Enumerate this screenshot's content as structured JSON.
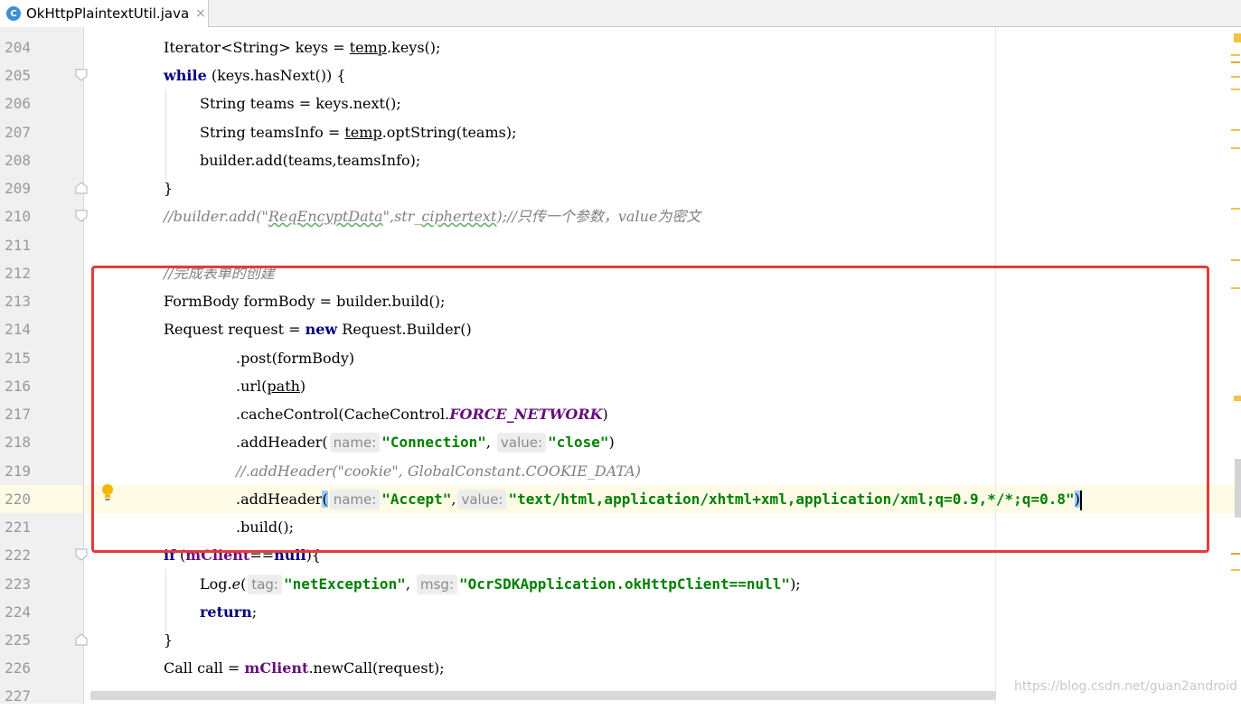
{
  "tab": {
    "icon_letter": "C",
    "title": "OkHttpPlaintextUtil.java",
    "close_glyph": "×"
  },
  "lines": [
    {
      "n": "204"
    },
    {
      "n": "205"
    },
    {
      "n": "206"
    },
    {
      "n": "207"
    },
    {
      "n": "208"
    },
    {
      "n": "209"
    },
    {
      "n": "210"
    },
    {
      "n": "211"
    },
    {
      "n": "212"
    },
    {
      "n": "213"
    },
    {
      "n": "214"
    },
    {
      "n": "215"
    },
    {
      "n": "216"
    },
    {
      "n": "217"
    },
    {
      "n": "218"
    },
    {
      "n": "219"
    },
    {
      "n": "220"
    },
    {
      "n": "221"
    },
    {
      "n": "222"
    },
    {
      "n": "223"
    },
    {
      "n": "224"
    },
    {
      "n": "225"
    },
    {
      "n": "226"
    },
    {
      "n": "227"
    }
  ],
  "code": {
    "l204": "Iterator<String> keys = ",
    "l204_temp": "temp",
    "l204_tail": ".keys();",
    "l205_kw": "while",
    "l205_tail": " (keys.hasNext()) {",
    "l206": "String teams = keys.next();",
    "l207_a": "String teamsInfo = ",
    "l207_temp": "temp",
    "l207_b": ".optString(teams);",
    "l208": "builder.add(teams,teamsInfo);",
    "l209": "}",
    "l210_a": "//builder.add(\"",
    "l210_wavy": "ReqEncyptData",
    "l210_b": "\",str_",
    "l210_wavy2": "ciphertext",
    "l210_c": ");//只传一个参数，value为密文",
    "l212": "//完成表单的创建",
    "l213": "FormBody formBody = builder.build();",
    "l214_a": "Request request = ",
    "l214_kw": "new",
    "l214_b": " Request.Builder()",
    "l215": ".post(formBody)",
    "l216_a": ".url(",
    "l216_path": "path",
    "l216_b": ")",
    "l217_a": ".cacheControl(CacheControl.",
    "l217_fld": "FORCE_NETWORK",
    "l217_b": ")",
    "l218_a": ".addHeader(",
    "l218_hint1": "name:",
    "l218_s1": "\"Connection\"",
    "l218_comma": ", ",
    "l218_hint2": "value:",
    "l218_s2": "\"close\"",
    "l218_b": ")",
    "l219": "//.addHeader(\"cookie\", GlobalConstant.COOKIE_DATA)",
    "l220_a": ".addHeader",
    "l220_open": "(",
    "l220_hint1": "name:",
    "l220_s1": "\"Accept\"",
    "l220_comma": ",",
    "l220_hint2": "value:",
    "l220_s2": "\"text/html,application/xhtml+xml,application/xml;q=0.9,*/*;q=0.8\"",
    "l220_close": ")",
    "l221": ".build();",
    "l222_kw": "if",
    "l222_a": " (",
    "l222_fld": "mClient",
    "l222_b": "==",
    "l222_null": "null",
    "l222_c": "){",
    "l223_a": "Log.",
    "l223_e": "e",
    "l223_open": "(",
    "l223_hint1": "tag:",
    "l223_s1": "\"netException\"",
    "l223_comma": ", ",
    "l223_hint2": "msg:",
    "l223_s2": "\"OcrSDKApplication.okHttpClient==null\"",
    "l223_b": ");",
    "l224_kw": "return",
    "l224_b": ";",
    "l225": "}",
    "l226_a": "Call call = ",
    "l226_fld": "mClient",
    "l226_b": ".newCall(request);"
  },
  "watermark": "https://blog.csdn.net/guan2android",
  "colors": {
    "keyword": "#000080",
    "string": "#008000",
    "comment": "#808080",
    "field": "#660e7a",
    "highlight_box": "#e63a3a",
    "caret_line": "#fdfbe6"
  }
}
